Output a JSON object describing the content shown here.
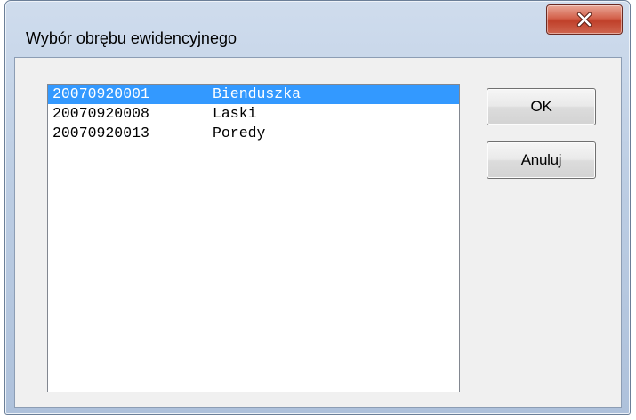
{
  "window": {
    "title": "Wybór obrębu ewidencyjnego",
    "close_icon": "close-x-icon"
  },
  "list": {
    "selected_index": 0,
    "items": [
      {
        "code": "20070920001",
        "name": "Bienduszka"
      },
      {
        "code": "20070920008",
        "name": "Laski"
      },
      {
        "code": "20070920013",
        "name": "Poredy"
      }
    ]
  },
  "buttons": {
    "ok_label": "OK",
    "cancel_label": "Anuluj"
  },
  "colors": {
    "selection": "#3399ff",
    "close_button": "#c94a35",
    "dialog_background": "#f0f0f0"
  }
}
